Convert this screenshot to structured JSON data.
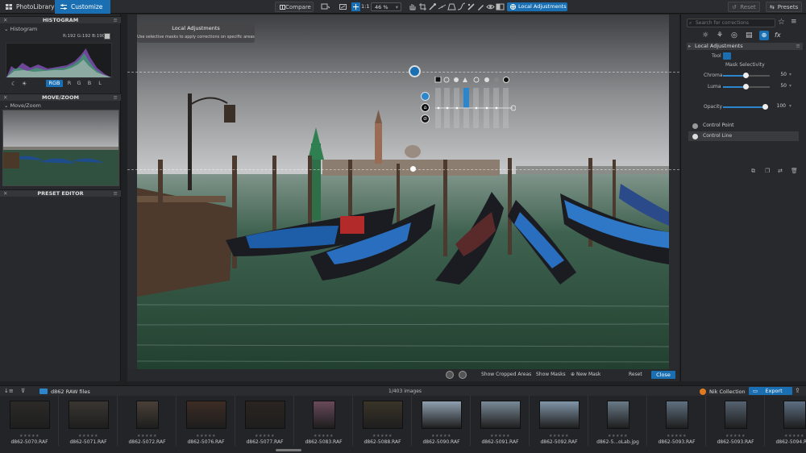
{
  "topbar": {
    "tabs": [
      {
        "label": "PhotoLibrary"
      },
      {
        "label": "Customize"
      }
    ],
    "compare_label": "Compare",
    "zoom_1to1": "1:1",
    "zoom_value": "46 %",
    "local_adjustments_label": "Local Adjustments",
    "reset_label": "Reset",
    "presets_label": "Presets"
  },
  "left_panel": {
    "histogram_header": "HISTOGRAM",
    "histogram_label": "Histogram",
    "rgb_readout": "R:192 G:192 B:190",
    "channels": [
      "RGB",
      "R",
      "G",
      "B",
      "L"
    ],
    "move_zoom_header": "MOVE/ZOOM",
    "move_zoom_label": "Move/Zoom",
    "preset_editor_header": "PRESET EDITOR"
  },
  "canvas": {
    "tooltip_title": "Local Adjustments",
    "tooltip_desc": "Use selective masks to apply corrections on specific areas",
    "bar": {
      "show_cropped": "Show Cropped Areas",
      "show_masks": "Show Masks",
      "new_mask": "New Mask",
      "reset": "Reset",
      "close": "Close"
    }
  },
  "right_panel": {
    "search_placeholder": "Search for corrections",
    "header": "Local Adjustments",
    "tool_label": "Tool",
    "mask_selectivity": "Mask Selectivity",
    "chroma_label": "Chroma",
    "chroma_value": "50",
    "luma_label": "Luma",
    "luma_value": "50",
    "opacity_label": "Opacity",
    "opacity_value": "100",
    "control_point": "Control Point",
    "control_line": "Control Line",
    "accent": "#1a6fb2"
  },
  "filmstrip": {
    "folder_label": "d862 RAW files",
    "count_label": "1/403 images",
    "nik_label": "Nik Collection",
    "export_label": "Export",
    "thumbs": [
      {
        "name": "d862-5070.RAF",
        "stars": "★★★★★"
      },
      {
        "name": "d862-5071.RAF",
        "stars": "★★★★★"
      },
      {
        "name": "d862-5072.RAF",
        "stars": "★★★★★"
      },
      {
        "name": "d862-5076.RAF",
        "stars": "★★★★★"
      },
      {
        "name": "d862-5077.RAF",
        "stars": "★★★★★"
      },
      {
        "name": "d862-5083.RAF",
        "stars": "★★★★★"
      },
      {
        "name": "d862-5088.RAF",
        "stars": "★★★★★"
      },
      {
        "name": "d862-5090.RAF",
        "stars": "★★★★★"
      },
      {
        "name": "d862-5091.RAF",
        "stars": "★★★★★"
      },
      {
        "name": "d862-5092.RAF",
        "stars": "★★★★★"
      },
      {
        "name": "d862-5...oLab.jpg",
        "stars": "★★★★★"
      },
      {
        "name": "d862-5093.RAF",
        "stars": "★★★★★"
      },
      {
        "name": "d862-5093.RAF",
        "stars": "★★★★★"
      },
      {
        "name": "d862-5094.RAF",
        "stars": "★★★★★"
      }
    ]
  }
}
